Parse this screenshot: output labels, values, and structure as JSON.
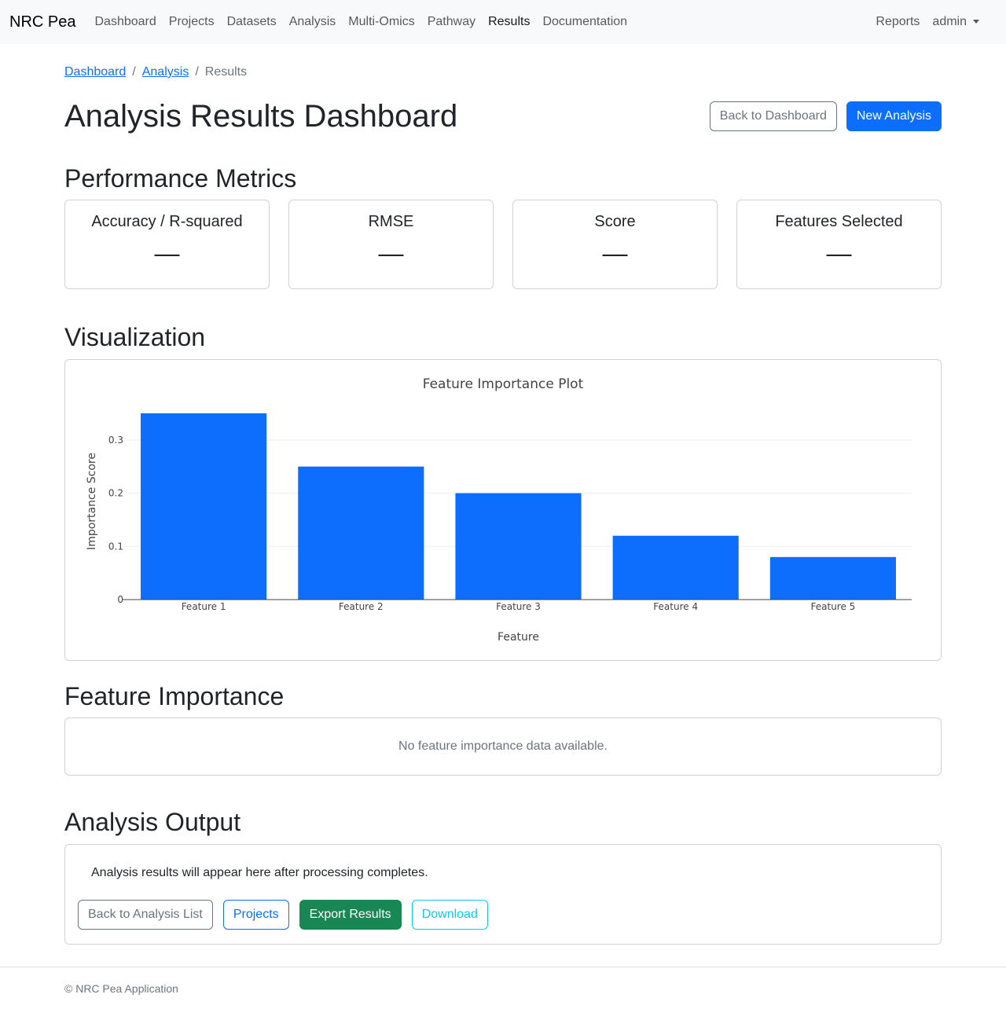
{
  "navbar": {
    "brand": "NRC Pea",
    "links": [
      "Dashboard",
      "Projects",
      "Datasets",
      "Analysis",
      "Multi-Omics",
      "Pathway",
      "Results",
      "Documentation"
    ],
    "right": {
      "reports": "Reports",
      "user": "admin"
    }
  },
  "breadcrumb": {
    "dashboard": "Dashboard",
    "analysis": "Analysis",
    "current": "Results",
    "separator": "/"
  },
  "header": {
    "title": "Analysis Results Dashboard",
    "back_label": "Back to Dashboard",
    "new_label": "New Analysis"
  },
  "metrics": {
    "title": "Performance Metrics",
    "cards": [
      {
        "label": "Accuracy / R-squared",
        "value": "—"
      },
      {
        "label": "RMSE",
        "value": "—"
      },
      {
        "label": "Score",
        "value": "—"
      },
      {
        "label": "Features Selected",
        "value": "—"
      }
    ]
  },
  "visualization": {
    "title": "Visualization"
  },
  "chart_data": {
    "type": "bar",
    "title": "Feature Importance Plot",
    "xlabel": "Feature",
    "ylabel": "Importance Score",
    "categories": [
      "Feature 1",
      "Feature 2",
      "Feature 3",
      "Feature 4",
      "Feature 5"
    ],
    "values": [
      0.35,
      0.25,
      0.2,
      0.12,
      0.08
    ],
    "ylim": [
      0,
      0.35
    ],
    "yticks": [
      0,
      0.1,
      0.2,
      0.3
    ],
    "ytick_labels": [
      "0",
      "0.1",
      "0.2",
      "0.3"
    ],
    "grid": true,
    "color": "#0d6efd"
  },
  "feature_importance": {
    "title": "Feature Importance",
    "empty_text": "No feature importance data available."
  },
  "analysis_output": {
    "title": "Analysis Output",
    "text": "Analysis results will appear here after processing completes.",
    "buttons": {
      "back": "Back to Analysis List",
      "projects": "Projects",
      "export": "Export Results",
      "download": "Download"
    }
  },
  "footer": {
    "text": "© NRC Pea Application"
  }
}
